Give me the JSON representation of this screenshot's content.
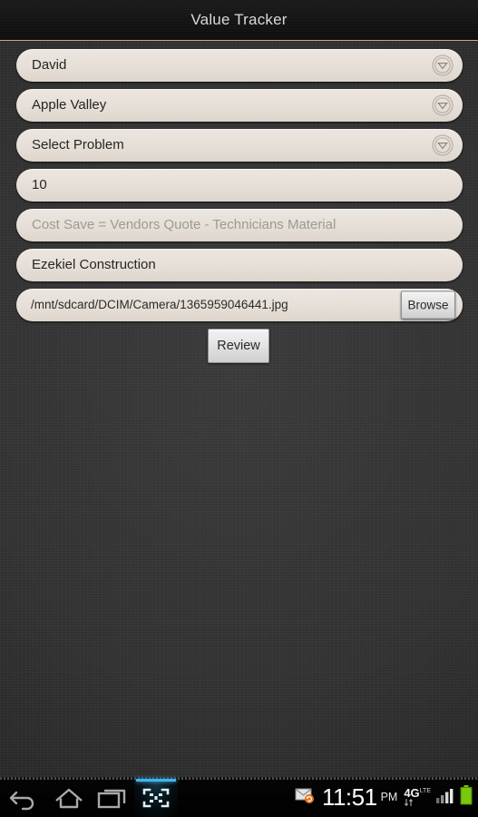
{
  "app": {
    "title": "Value Tracker",
    "accent_divider_color": "#c9a57d",
    "background_color": "#313131",
    "field_fill_color": "#e6dfd7"
  },
  "form": {
    "fields": [
      {
        "name": "technician-dropdown",
        "type": "dropdown",
        "value": "David",
        "is_placeholder": false,
        "icon": "chevron-down-circle-icon"
      },
      {
        "name": "location-dropdown",
        "type": "dropdown",
        "value": "Apple Valley",
        "is_placeholder": false,
        "icon": "chevron-down-circle-icon"
      },
      {
        "name": "problem-dropdown",
        "type": "dropdown",
        "value": "Select Problem",
        "is_placeholder": false,
        "icon": "chevron-down-circle-icon"
      },
      {
        "name": "quantity-input",
        "type": "text",
        "value": "10",
        "is_placeholder": false
      },
      {
        "name": "cost-save-input",
        "type": "text",
        "value": "Cost Save = Vendors Quote - Technicians Material",
        "is_placeholder": true
      },
      {
        "name": "vendor-input",
        "type": "text",
        "value": "Ezekiel Construction",
        "is_placeholder": false
      }
    ],
    "file_field": {
      "name": "photo-path-input",
      "value": "/mnt/sdcard/DCIM/Camera/1365959046441.jpg",
      "browse_label": "Browse"
    },
    "review_label": "Review"
  },
  "navbar": {
    "items": [
      {
        "name": "back-icon",
        "label": "Back"
      },
      {
        "name": "home-icon",
        "label": "Home"
      },
      {
        "name": "recents-icon",
        "label": "Recent apps"
      },
      {
        "name": "screenshot-icon",
        "label": "Screenshot",
        "active": true
      }
    ]
  },
  "status": {
    "email_icon": "email-sync-icon",
    "time": "11:51",
    "ampm": "PM",
    "network": "4G",
    "network_sub": "LTE",
    "signal_icon": "signal-bars-icon",
    "battery_icon": "battery-full-icon",
    "battery_color": "#7ac70c"
  }
}
